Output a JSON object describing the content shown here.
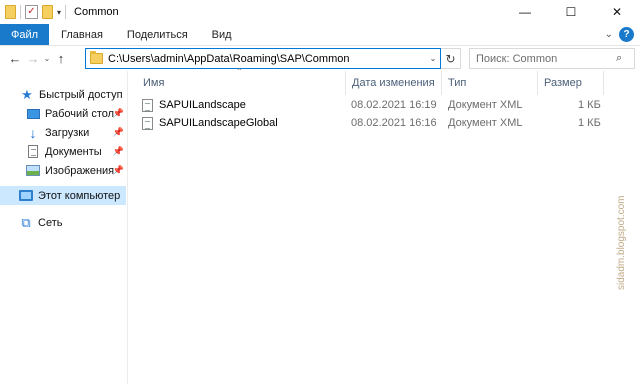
{
  "window": {
    "title": "Common",
    "controls": {
      "minimize": "—",
      "maximize": "☐",
      "close": "✕"
    }
  },
  "ribbon": {
    "tabs": [
      "Файл",
      "Главная",
      "Поделиться",
      "Вид"
    ]
  },
  "address_bar": {
    "path": "C:\\Users\\admin\\AppData\\Roaming\\SAP\\Common",
    "search_placeholder": "Поиск: Common"
  },
  "nav_pane": {
    "quick_access": "Быстрый доступ",
    "items": [
      {
        "label": "Рабочий стол",
        "icon": "desktop-icon",
        "pinned": true
      },
      {
        "label": "Загрузки",
        "icon": "downloads-icon",
        "pinned": true
      },
      {
        "label": "Документы",
        "icon": "documents-icon",
        "pinned": true
      },
      {
        "label": "Изображения",
        "icon": "pictures-icon",
        "pinned": true
      }
    ],
    "this_pc": "Этот компьютер",
    "network": "Сеть"
  },
  "file_list": {
    "columns": [
      "Имя",
      "Дата изменения",
      "Тип",
      "Размер"
    ],
    "rows": [
      {
        "name": "SAPUILandscape",
        "modified": "08.02.2021 16:19",
        "type": "Документ XML",
        "size": "1 КБ"
      },
      {
        "name": "SAPUILandscapeGlobal",
        "modified": "08.02.2021 16:16",
        "type": "Документ XML",
        "size": "1 КБ"
      }
    ]
  },
  "watermark": "sidadm.blogspot.com",
  "colors": {
    "accent": "#1979ca",
    "selection": "#cce8ff",
    "address_border": "#0078d7"
  }
}
